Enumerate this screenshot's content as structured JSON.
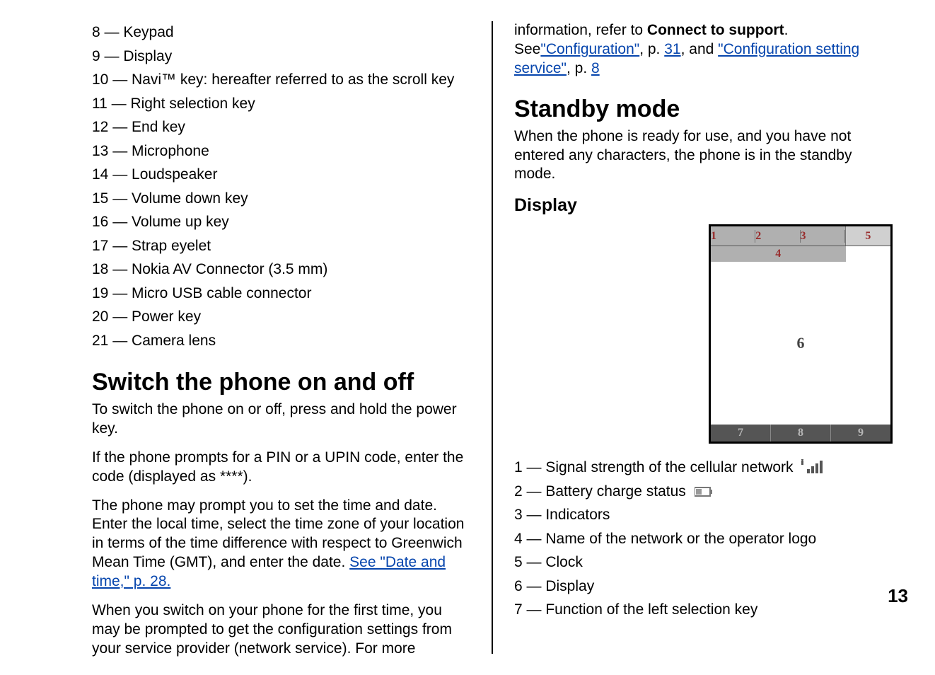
{
  "left": {
    "items": [
      "8 — Keypad",
      "9 — Display",
      "10 — Navi™ key: hereafter referred to as the scroll key",
      "11 — Right selection key",
      "12 — End key",
      "13 — Microphone",
      "14 — Loudspeaker",
      "15 — Volume down key",
      "16 — Volume up key",
      "17 — Strap eyelet",
      "18 — Nokia AV Connector (3.5 mm)",
      "19 — Micro USB cable connector",
      "20 — Power key",
      "21 — Camera lens"
    ],
    "h1": "Switch the phone on and off",
    "p1": "To switch the phone on or off, press and hold the power key.",
    "p2": "If the phone prompts for a PIN or a UPIN code, enter the code (displayed as ****).",
    "p3_a": "The phone may prompt you to set the time and date. Enter the local time, select the time zone of your location in terms of the time difference with respect to Greenwich Mean Time (GMT), and enter the date. ",
    "p3_link": "See \"Date and time,\" p. 28.",
    "p4": "When you switch on your phone for the first time, you may be prompted to get the configuration settings from your service provider (network service). For more"
  },
  "right": {
    "intro_a": "information, refer to ",
    "intro_b": "Connect to support",
    "intro_c": ". See",
    "link1": "\"Configuration\"",
    "mid1": ", p. ",
    "link_p1": "31",
    "mid2": ", and ",
    "link2": "\"Configuration setting service\"",
    "mid3": ", p. ",
    "link_p2": "8",
    "h1": "Standby mode",
    "p1": "When the phone is ready for use, and you have not entered any characters, the phone is in the standby mode.",
    "h2": "Display",
    "fig": {
      "top1": "1",
      "top2": "2",
      "top3": "3",
      "top5": "5",
      "top4": "4",
      "center": "6",
      "bot1": "7",
      "bot2": "8",
      "bot3": "9"
    },
    "d1_a": "1 — Signal strength of the cellular network ",
    "d2_a": "2 — Battery charge status ",
    "d3": "3 — Indicators",
    "d4": "4 — Name of the network or the operator logo",
    "d5": "5 — Clock",
    "d6": "6 — Display",
    "d7": "7 — Function of the left selection key"
  },
  "page_number": "13"
}
